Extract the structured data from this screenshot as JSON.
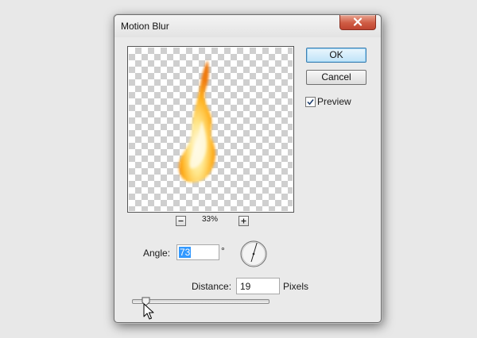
{
  "dialog": {
    "title": "Motion Blur",
    "close_icon": "close-x-icon"
  },
  "buttons": {
    "ok_label": "OK",
    "cancel_label": "Cancel"
  },
  "preview": {
    "checkbox_label": "Preview",
    "checked": true,
    "zoom_label": "33%",
    "zoom_out_icon": "minus-icon",
    "zoom_in_icon": "plus-icon",
    "image": "flame-on-transparency"
  },
  "angle": {
    "label": "Angle:",
    "value": "73",
    "unit": "°",
    "dial_icon": "angle-dial-icon"
  },
  "distance": {
    "label": "Distance:",
    "value": "19",
    "unit": "Pixels",
    "slider_fraction": 0.1
  },
  "colors": {
    "accent": "#3399ff",
    "close_button": "#cf5c44",
    "default_button": "#bfe3f8"
  }
}
